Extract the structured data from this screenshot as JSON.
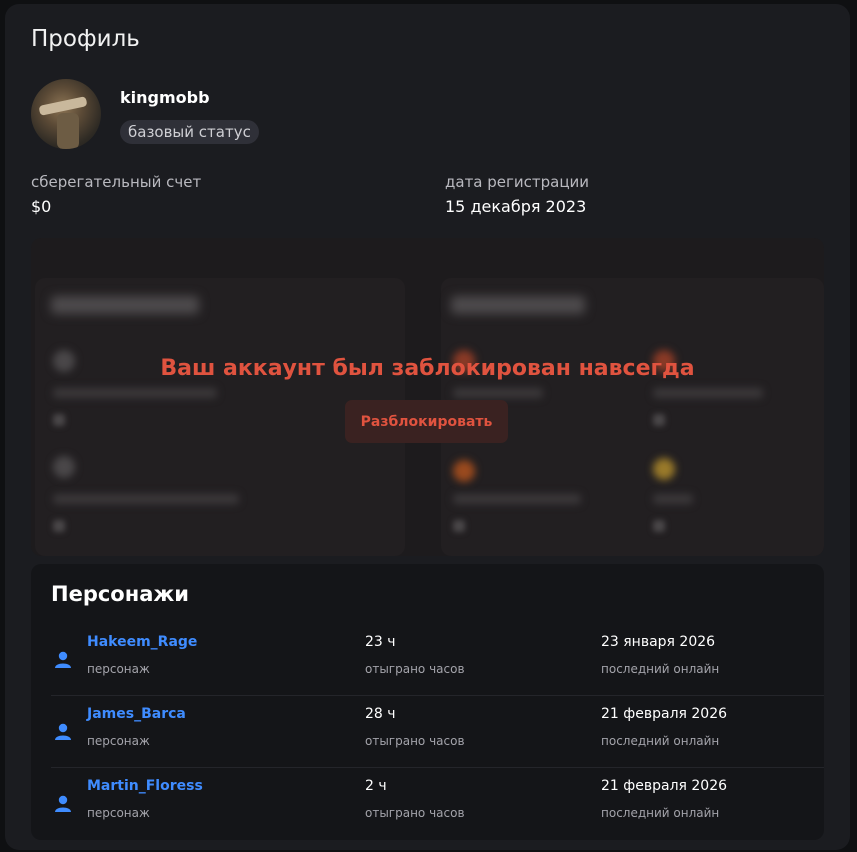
{
  "page": {
    "title": "Профиль"
  },
  "profile": {
    "username": "kingmobb",
    "status": "базовый статус",
    "savings_label": "сберегательный счет",
    "savings_value": "$0",
    "reg_label": "дата регистрации",
    "reg_value": "15 декабря 2023"
  },
  "blocked": {
    "message": "Ваш аккаунт был заблокирован навсегда",
    "button": "Разблокировать"
  },
  "characters": {
    "title": "Персонажи",
    "items": [
      {
        "name": "Hakeem_Rage",
        "type": "персонаж",
        "hours": "23 ч",
        "hours_label": "отыграно часов",
        "last_online": "23 января 2026",
        "last_online_label": "последний онлайн"
      },
      {
        "name": "James_Barca",
        "type": "персонаж",
        "hours": "28 ч",
        "hours_label": "отыграно часов",
        "last_online": "21 февраля 2026",
        "last_online_label": "последний онлайн"
      },
      {
        "name": "Martin_Floress",
        "type": "персонаж",
        "hours": "2 ч",
        "hours_label": "отыграно часов",
        "last_online": "21 февраля 2026",
        "last_online_label": "последний онлайн"
      }
    ]
  },
  "colors": {
    "accent_red": "#e0533f",
    "link_blue": "#3f8cff",
    "card_bg": "#1b1c20"
  }
}
